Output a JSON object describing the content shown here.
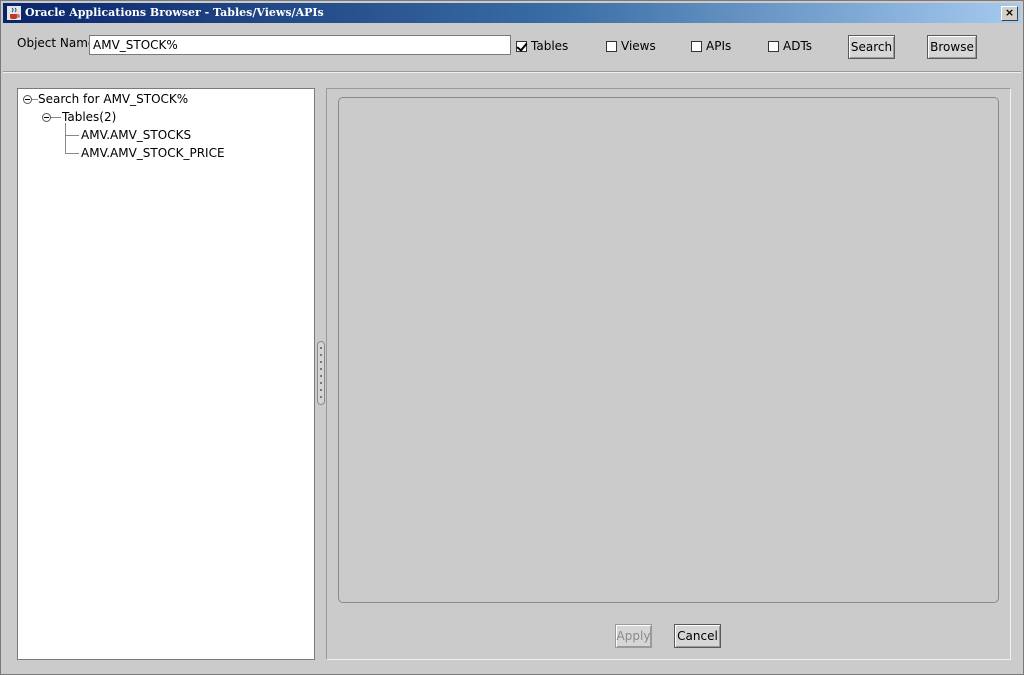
{
  "window": {
    "title": "Oracle Applications Browser - Tables/Views/APIs",
    "close_label": "×"
  },
  "search": {
    "label": "Object Name",
    "value": "AMV_STOCK%",
    "options": [
      {
        "label": "Tables",
        "checked": true
      },
      {
        "label": "Views",
        "checked": false
      },
      {
        "label": "APIs",
        "checked": false
      },
      {
        "label": "ADTs",
        "checked": false
      }
    ],
    "search_button": "Search",
    "browse_button": "Browse"
  },
  "tree": {
    "root": "Search for AMV_STOCK%",
    "group": "Tables(2)",
    "items": [
      "AMV.AMV_STOCKS",
      "AMV.AMV_STOCK_PRICE"
    ]
  },
  "footer": {
    "apply_button": "Apply",
    "cancel_button": "Cancel"
  }
}
